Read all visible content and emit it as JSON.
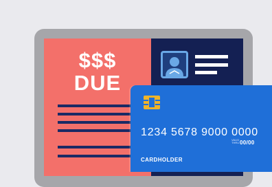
{
  "bill": {
    "amount_symbol": "$$$",
    "label": "DUE"
  },
  "card": {
    "number": "1234  5678  9000  0000",
    "valid_thru_label": "VALID THRU",
    "expiry": "00/00",
    "holder_label": "CARDHOLDER"
  },
  "colors": {
    "background": "#eaeaee",
    "frame": "#a6a6aa",
    "bill": "#f3706a",
    "panel": "#142053",
    "card": "#1f6fd8",
    "chip": "#f0b429"
  },
  "icons": [
    "user-avatar-icon",
    "card-chip-icon"
  ]
}
